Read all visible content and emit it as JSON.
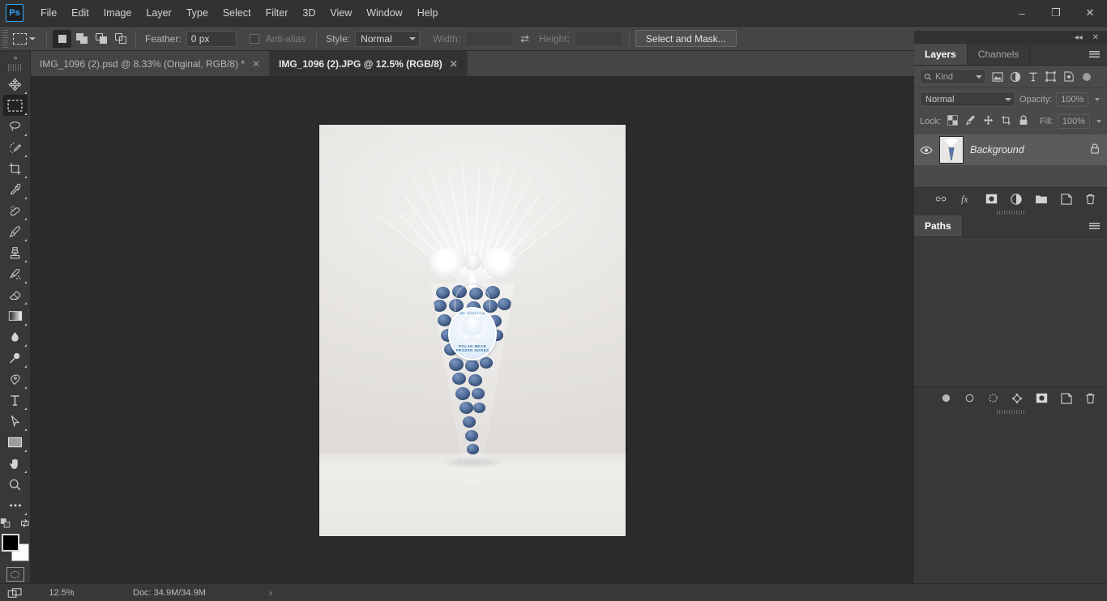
{
  "app": {
    "name": "Adobe Photoshop",
    "logo_text": "Ps"
  },
  "menubar": {
    "items": [
      {
        "label": "File"
      },
      {
        "label": "Edit"
      },
      {
        "label": "Image"
      },
      {
        "label": "Layer"
      },
      {
        "label": "Type"
      },
      {
        "label": "Select"
      },
      {
        "label": "Filter"
      },
      {
        "label": "3D"
      },
      {
        "label": "View"
      },
      {
        "label": "Window"
      },
      {
        "label": "Help"
      }
    ],
    "window_controls": {
      "minimize": "–",
      "restore": "❐",
      "close": "✕"
    }
  },
  "options_bar": {
    "tool": "rectangular-marquee-tool",
    "feather_label": "Feather:",
    "feather_value": "0 px",
    "antialias_label": "Anti-alias",
    "antialias_checked": false,
    "style_label": "Style:",
    "style_value": "Normal",
    "width_label": "Width:",
    "width_value": "",
    "height_label": "Height:",
    "height_value": "",
    "swap_icon": "swap-width-height-icon",
    "select_and_mask": "Select and Mask..."
  },
  "tabs": [
    {
      "label": "IMG_1096 (2).psd @ 8.33% (Original, RGB/8) *",
      "active": false,
      "close": "✕"
    },
    {
      "label": "IMG_1096 (2).JPG @ 12.5% (RGB/8)",
      "active": true,
      "close": "✕"
    }
  ],
  "toolbar": {
    "collapse_icon": "»",
    "tools": [
      {
        "name": "move-tool",
        "active": false
      },
      {
        "name": "rectangular-marquee-tool",
        "active": true
      },
      {
        "name": "lasso-tool",
        "active": false
      },
      {
        "name": "quick-selection-tool",
        "active": false
      },
      {
        "name": "crop-tool",
        "active": false
      },
      {
        "name": "eyedropper-tool",
        "active": false
      },
      {
        "name": "spot-healing-brush-tool",
        "active": false
      },
      {
        "name": "brush-tool",
        "active": false
      },
      {
        "name": "clone-stamp-tool",
        "active": false
      },
      {
        "name": "history-brush-tool",
        "active": false
      },
      {
        "name": "eraser-tool",
        "active": false
      },
      {
        "name": "gradient-tool",
        "active": false
      },
      {
        "name": "blur-tool",
        "active": false
      },
      {
        "name": "dodge-tool",
        "active": false
      },
      {
        "name": "pen-tool",
        "active": false
      },
      {
        "name": "horizontal-type-tool",
        "active": false
      },
      {
        "name": "path-selection-tool",
        "active": false
      },
      {
        "name": "rectangle-tool",
        "active": false
      },
      {
        "name": "hand-tool",
        "active": false
      },
      {
        "name": "zoom-tool",
        "active": false
      },
      {
        "name": "edit-toolbar-tool",
        "active": false
      }
    ],
    "foreground_color": "#000000",
    "background_color": "#ffffff",
    "quick_mask": "edit-in-quick-mask-mode"
  },
  "canvas": {
    "image_alt": "Polar Bear Frozen Noses chocolate cone favour wrapped in cellophane with white bow",
    "tag_top_text": "PURE CHOCOLATE",
    "tag_bottom_text": "POLAR BEAR FROZEN NOSES"
  },
  "panels": {
    "collapse_icon": "◂◂",
    "close_icon": "✕",
    "layers": {
      "tabs": [
        {
          "label": "Layers",
          "active": true
        },
        {
          "label": "Channels",
          "active": false
        }
      ],
      "filter": {
        "kind_label": "Kind",
        "search_icon": "search-icon",
        "icons": [
          "pixel-layer-filter-icon",
          "adjustment-layer-filter-icon",
          "type-layer-filter-icon",
          "shape-layer-filter-icon",
          "smart-object-filter-icon"
        ],
        "toggle": "filter-toggle"
      },
      "blend_mode": "Normal",
      "opacity_label": "Opacity:",
      "opacity_value": "100%",
      "lock_label": "Lock:",
      "lock_icons": [
        "lock-transparent-pixels-icon",
        "lock-image-pixels-icon",
        "lock-position-icon",
        "lock-artboard-nesting-icon",
        "lock-all-icon"
      ],
      "fill_label": "Fill:",
      "fill_value": "100%",
      "rows": [
        {
          "name": "Background",
          "visible": true,
          "locked": true
        }
      ],
      "footer_icons": [
        "link-layers-icon",
        "add-layer-style-icon",
        "add-layer-mask-icon",
        "new-fill-adjustment-layer-icon",
        "new-group-icon",
        "new-layer-icon",
        "delete-layer-icon"
      ]
    },
    "paths": {
      "tabs": [
        {
          "label": "Paths",
          "active": true
        }
      ],
      "footer_icons": [
        "fill-path-icon",
        "stroke-path-icon",
        "load-path-as-selection-icon",
        "make-work-path-icon",
        "add-layer-mask-icon",
        "new-path-icon",
        "delete-path-icon"
      ]
    }
  },
  "statusbar": {
    "zoom": "12.5%",
    "doc_info": "Doc: 34.9M/34.9M",
    "arrow": "›"
  },
  "colors": {
    "accent": "#31a8ff",
    "panel_bg": "#4a4a4a",
    "chrome_bg": "#383838",
    "canvas_bg": "#2b2b2b",
    "bead_blue": "#54719e"
  }
}
